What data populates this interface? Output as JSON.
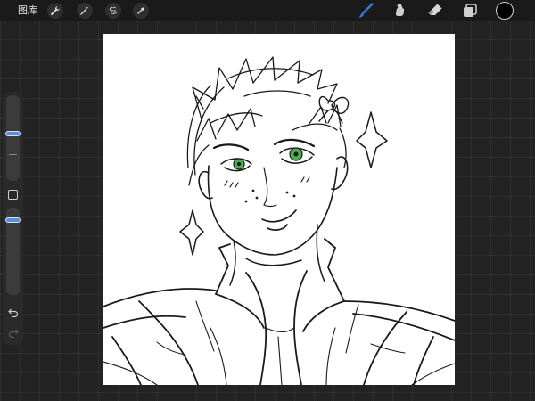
{
  "topbar": {
    "gallery_label": "图库",
    "left_tools": [
      {
        "name": "actions",
        "icon": "wrench-icon"
      },
      {
        "name": "adjustments",
        "icon": "magic-wand-icon"
      },
      {
        "name": "selection",
        "icon": "selection-s-icon"
      },
      {
        "name": "transform",
        "icon": "arrow-cursor-icon"
      }
    ],
    "right_tools": [
      {
        "name": "brush",
        "icon": "brush-icon",
        "active": true
      },
      {
        "name": "smudge",
        "icon": "smudge-icon",
        "active": false
      },
      {
        "name": "eraser",
        "icon": "eraser-icon",
        "active": false
      },
      {
        "name": "layers",
        "icon": "layers-icon",
        "active": false
      }
    ],
    "current_color": "#000000"
  },
  "sidebar": {
    "brush_size_level": 0.55,
    "opacity_level": 0.88
  },
  "colors": {
    "accent": "#3a7bd5",
    "canvas": "#ffffff",
    "ink": "#1a1a1a",
    "eye": "#4caf50",
    "background": "#232323"
  }
}
